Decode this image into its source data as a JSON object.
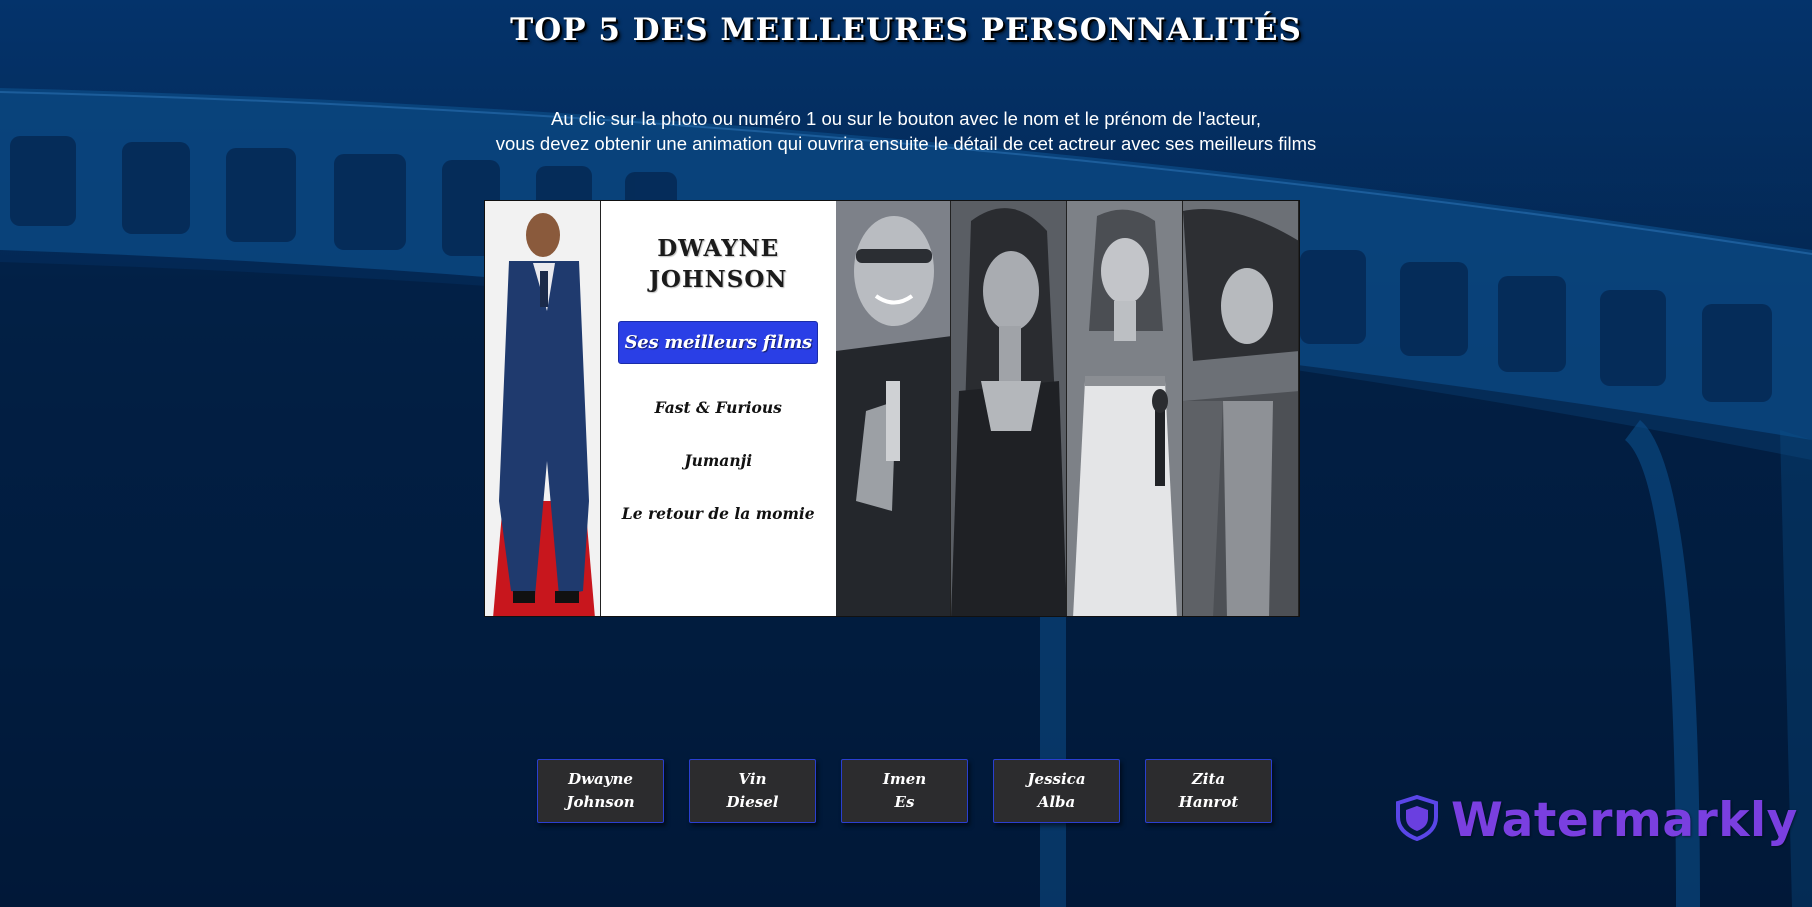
{
  "page": {
    "title": "TOP 5 DES MEILLEURES PERSONNALITÉS",
    "instructions_line1": "Au clic sur la photo ou numéro 1 ou sur le bouton avec le nom et le prénom de l'acteur,",
    "instructions_line2": "vous devez obtenir une animation qui ouvrira ensuite le détail de cet actreur avec ses meilleurs films"
  },
  "featured": {
    "name_line1": "DWAYNE",
    "name_line2": "JOHNSON",
    "films_button_label": "Ses meilleurs films",
    "films": [
      "Fast & Furious",
      "Jumanji",
      "Le retour de la momie"
    ]
  },
  "actors": [
    {
      "first": "Dwayne",
      "last": "Johnson"
    },
    {
      "first": "Vin",
      "last": "Diesel"
    },
    {
      "first": "Imen",
      "last": "Es"
    },
    {
      "first": "Jessica",
      "last": "Alba"
    },
    {
      "first": "Zita",
      "last": "Hanrot"
    }
  ],
  "watermark": {
    "text": "Watermarkly"
  },
  "colors": {
    "background": "#021a3d",
    "button_accent": "#2a3fe6",
    "actor_button_bg": "#2c2c2e",
    "watermark": "#7a3fe0"
  }
}
